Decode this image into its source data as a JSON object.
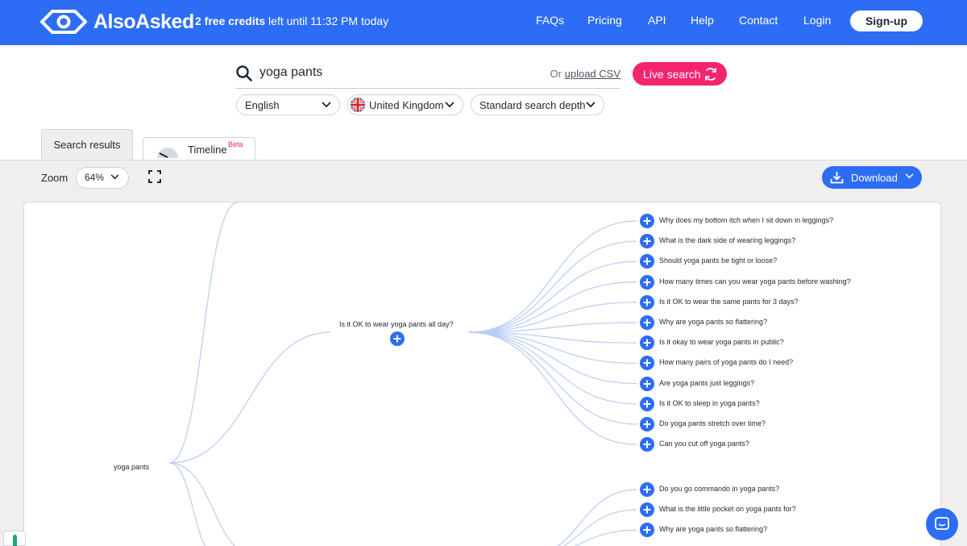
{
  "brand": {
    "name": "AlsoAsked",
    "color": "#2d6df6",
    "accent": "#f4246e"
  },
  "header": {
    "credits_bold": "2 free credits",
    "credits_rest": " left until 11:32 PM today",
    "nav": [
      "FAQs",
      "Pricing",
      "API",
      "Help",
      "Contact",
      "Login"
    ],
    "signup_label": "Sign-up"
  },
  "search": {
    "value": "yoga pants",
    "upload_prefix": "Or",
    "upload_link": "upload CSV",
    "live_button": "Live search",
    "language": "English",
    "region": "United Kingdom",
    "depth": "Standard search depth"
  },
  "tabs": {
    "results": "Search results",
    "timeline": "Timeline",
    "timeline_badge": "Beta"
  },
  "toolbar": {
    "zoom_label": "Zoom",
    "zoom_value": "64%",
    "download_label": "Download"
  },
  "tree": {
    "root": "yoga pants",
    "branch": "Is it OK to wear yoga pants all day?",
    "leaves_group1": [
      "Why does my bottom itch when I sit down in leggings?",
      "What is the dark side of wearing leggings?",
      "Should yoga pants be tight or loose?",
      "How many times can you wear yoga pants before washing?",
      "Is it OK to wear the same pants for 3 days?",
      "Why are yoga pants so flattering?",
      "Is it okay to wear yoga pants in public?",
      "How many pairs of yoga pants do I need?",
      "Are yoga pants just leggings?",
      "Is it OK to sleep in yoga pants?",
      "Do yoga pants stretch over time?",
      "Can you cut off yoga pants?"
    ],
    "leaves_group2": [
      "Do you go commando in yoga pants?",
      "What is the little pocket on yoga pants for?",
      "Why are yoga pants so flattering?"
    ]
  }
}
